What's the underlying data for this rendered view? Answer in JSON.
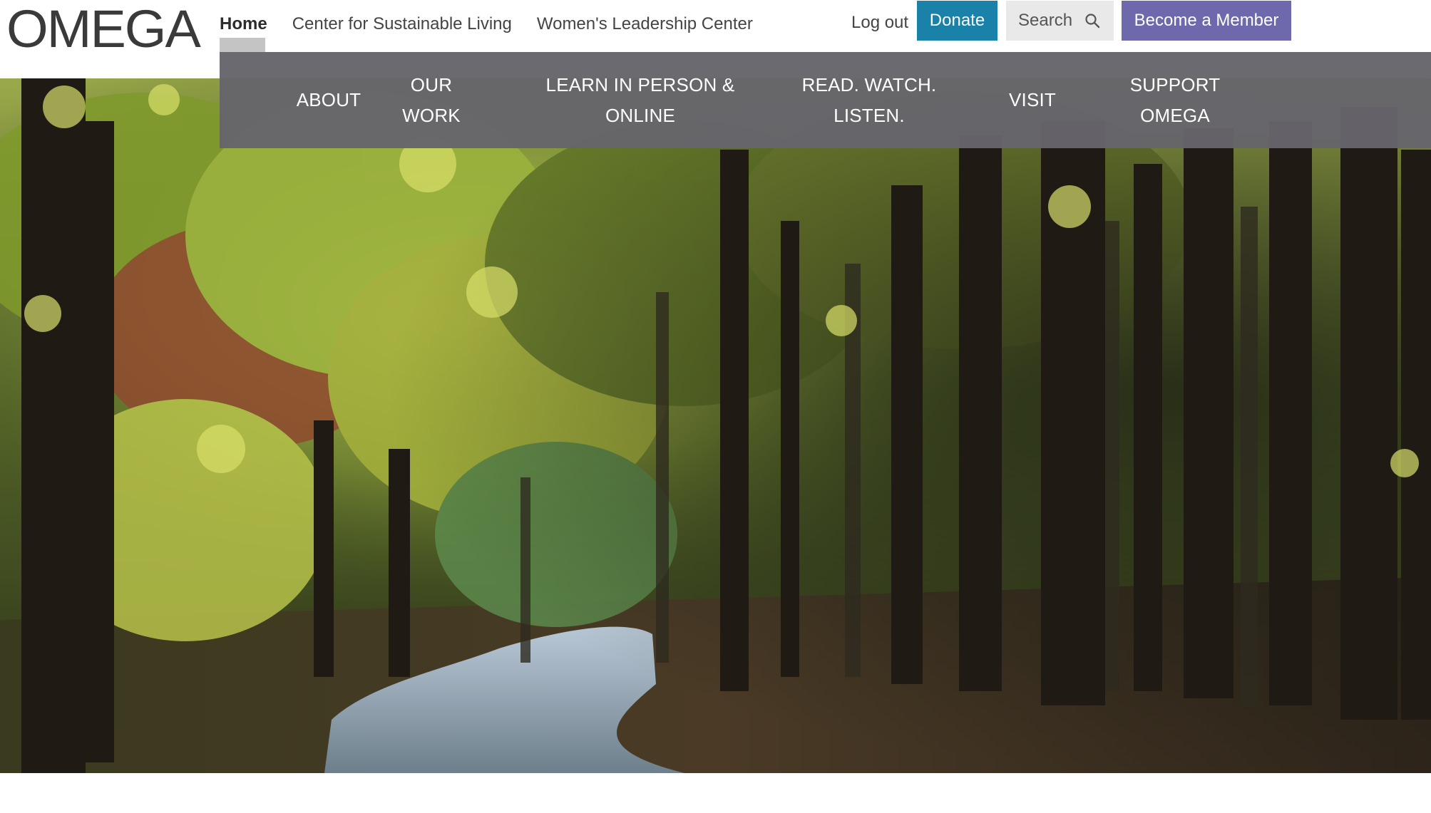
{
  "brand": {
    "logo_text": "OMEGA"
  },
  "site_nav": {
    "items": [
      {
        "label": "Home",
        "active": true
      },
      {
        "label": "Center for Sustainable Living",
        "active": false
      },
      {
        "label": "Women's Leadership Center",
        "active": false
      }
    ]
  },
  "utility": {
    "logout_label": "Log out",
    "donate_label": "Donate",
    "search_label": "Search",
    "member_label": "Become a Member"
  },
  "main_nav": {
    "items": [
      {
        "label": "ABOUT"
      },
      {
        "label": "OUR\nWORK"
      },
      {
        "label": "LEARN IN PERSON &\nONLINE"
      },
      {
        "label": "READ. WATCH.\nLISTEN."
      },
      {
        "label": "VISIT"
      },
      {
        "label": "SUPPORT\nOMEGA"
      }
    ]
  },
  "colors": {
    "donate": "#1a82a8",
    "member": "#6e68ad",
    "search_bg": "#e9e9ea",
    "main_nav_bg": "#66656b",
    "active_tab": "#c4c4c4"
  },
  "icons": {
    "search": "magnifier-icon"
  }
}
